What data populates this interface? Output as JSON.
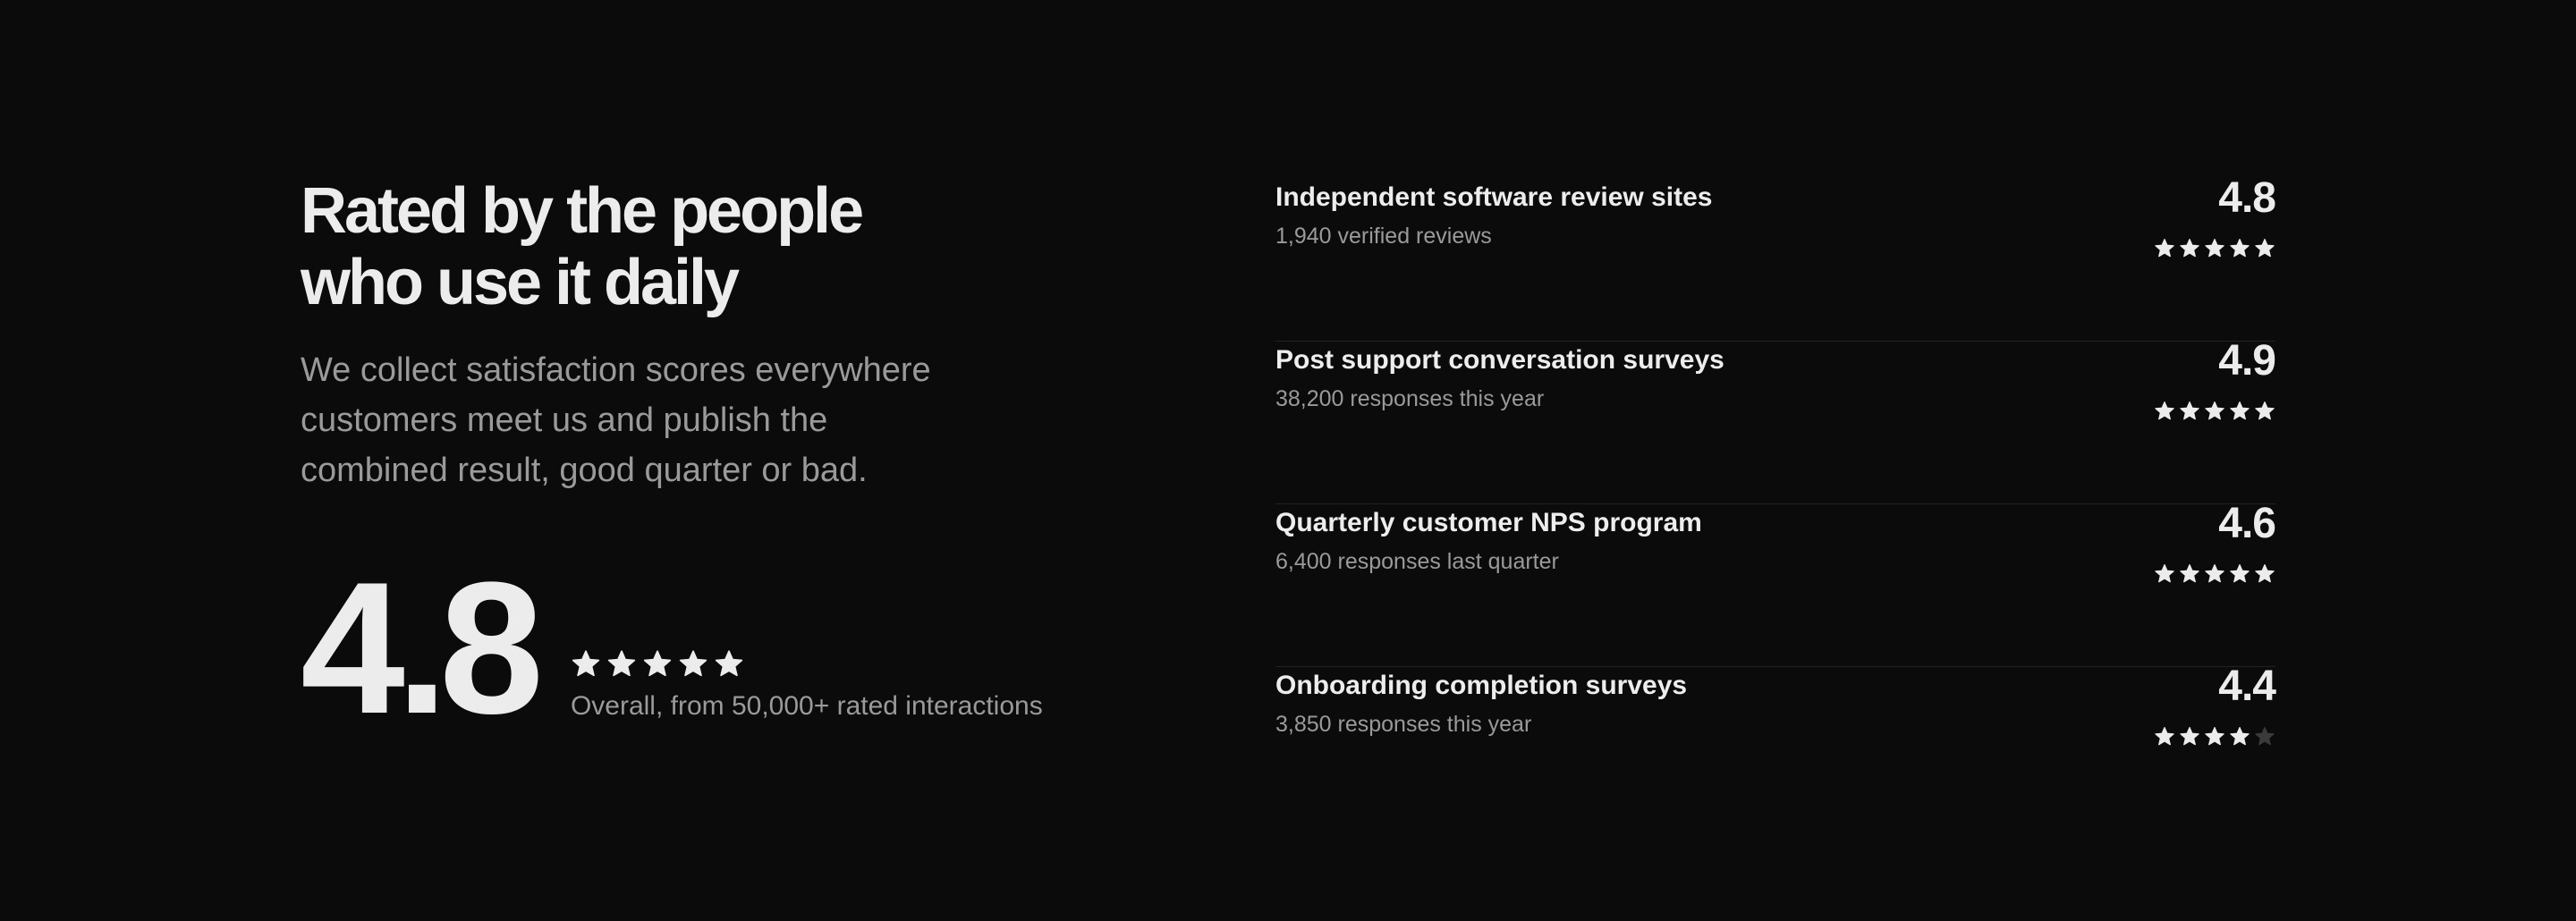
{
  "heading": {
    "title": "Rated by the people\nwho use it daily",
    "subtitle": "We collect satisfaction scores everywhere\ncustomers meet us and publish the\ncombined result, good quarter or bad."
  },
  "overall": {
    "score": "4.8",
    "stars_filled": 5,
    "stars_total": 5,
    "caption": "Overall, from 50,000+ rated interactions"
  },
  "colors": {
    "background": "#0b0b0b",
    "star_filled": "#ececec",
    "star_empty": "#3a3a3a",
    "muted_text": "#9a9a9a"
  },
  "sources": [
    {
      "title": "Independent software review sites",
      "meta": "1,940 verified reviews",
      "score": "4.8",
      "stars_filled": 5,
      "stars_total": 5
    },
    {
      "title": "Post support conversation surveys",
      "meta": "38,200 responses this year",
      "score": "4.9",
      "stars_filled": 5,
      "stars_total": 5
    },
    {
      "title": "Quarterly customer NPS program",
      "meta": "6,400 responses last quarter",
      "score": "4.6",
      "stars_filled": 5,
      "stars_total": 5
    },
    {
      "title": "Onboarding completion surveys",
      "meta": "3,850 responses this year",
      "score": "4.4",
      "stars_filled": 4,
      "stars_total": 5
    }
  ]
}
